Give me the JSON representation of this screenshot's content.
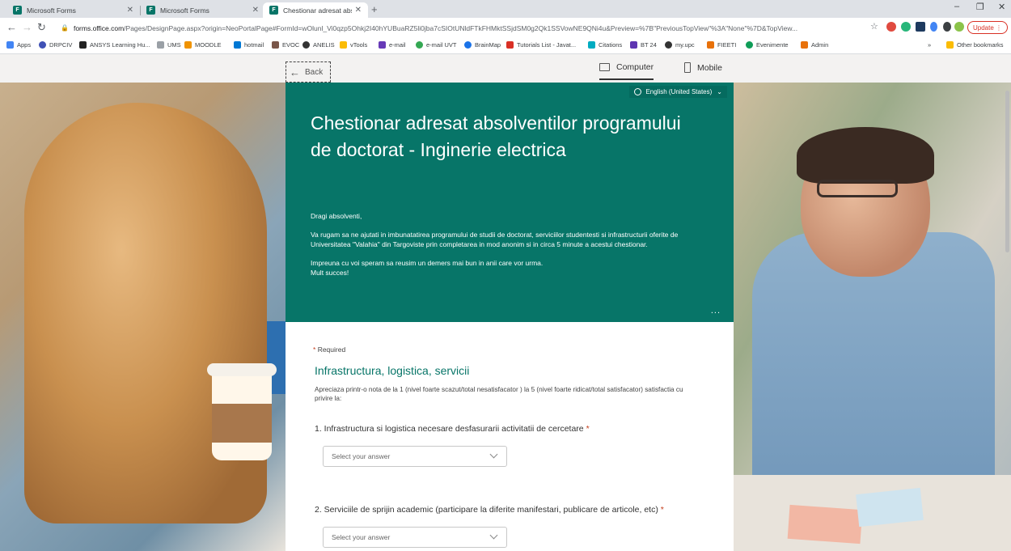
{
  "browser": {
    "tabs": [
      {
        "title": "Microsoft Forms",
        "active": false
      },
      {
        "title": "Microsoft Forms",
        "active": false
      },
      {
        "title": "Chestionar adresat absolventilor",
        "active": true
      }
    ],
    "url_host": "forms.office.com",
    "url_rest": "/Pages/DesignPage.aspx?origin=NeoPortalPage#FormId=wOlunl_Vi0qzp5Ohkj2I40hYUBuaRZ5li0jba7cSIOtUNldFTkFHMktSSjdSM0g2Qk1SSVowNE9QNi4u&Preview=%7B\"PreviousTopView\"%3A\"None\"%7D&TopView...",
    "update_label": "Update",
    "bookmarks": [
      "Apps",
      "DRPCIV",
      "ANSYS Learning Hu...",
      "UMS",
      "MOODLE",
      "hotmail",
      "EVOC",
      "ANELIS",
      "vTools",
      "e-mail",
      "e-mail UVT",
      "BrainMap",
      "Tutorials List - Javat...",
      "Citations",
      "BT 24",
      "my.upc",
      "FIEETI",
      "Evenimente",
      "Admin"
    ],
    "more_bookmarks": "»",
    "other_bookmarks": "Other bookmarks"
  },
  "preview_bar": {
    "back_label": "Back",
    "computer_label": "Computer",
    "mobile_label": "Mobile"
  },
  "form": {
    "language": "English (United States)",
    "title": "Chestionar adresat absolventilor programului de doctorat - Inginerie electrica",
    "description": [
      "Dragi absolventi,",
      "Va rugam sa ne ajutati in imbunatatirea programului de studii de doctorat, serviciilor studentesti si infrastructurii oferite de Universitatea \"Valahia\" din Targoviste prin completarea in mod anonim si in circa 5 minute a acestui chestionar.",
      "Impreuna cu voi speram sa reusim un demers mai bun in anii care vor urma.",
      "Mult succes!"
    ],
    "more": "...",
    "required_label": "Required",
    "section_title": "Infrastructura, logistica, servicii",
    "section_description": "Apreciaza printr-o nota de la 1 (nivel foarte scazut/total nesatisfacator ) la 5 (nivel foarte ridicat/total satisfacator) satisfactia cu privire la:",
    "questions": [
      {
        "text": "1. Infrastructura si logistica necesare desfasurarii activitatii de cercetare",
        "placeholder": "Select your answer"
      },
      {
        "text": "2. Serviciile de sprijin academic (participare la diferite manifestari, publicare de articole, etc)",
        "placeholder": "Select your answer"
      }
    ]
  }
}
